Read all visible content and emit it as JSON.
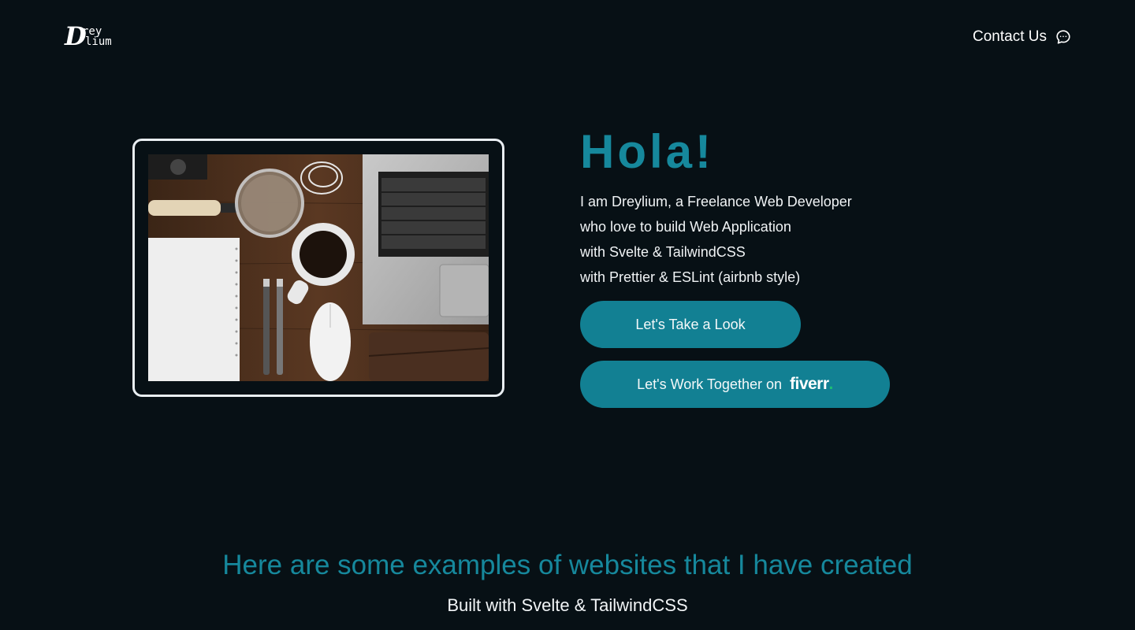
{
  "header": {
    "logo": {
      "big": "D",
      "line1": "rey",
      "line2": "lium"
    },
    "contact_label": "Contact Us",
    "contact_icon": "chat-bubble-icon"
  },
  "hero": {
    "image_alt": "Flat lay of a desk with notebook, magnifying glass, coffee cup, pens, mouse and laptop",
    "heading": "Hola!",
    "intro_lines": [
      "I am Dreylium, a Freelance Web Developer",
      "who love to build Web Application",
      "with Svelte & TailwindCSS",
      "with Prettier & ESLint (airbnb style)"
    ],
    "primary_button": "Let's Take a Look",
    "fiverr_button": "Let's Work Together on",
    "fiverr_logo_text": "fiverr",
    "fiverr_logo_dot": "."
  },
  "examples": {
    "title": "Here are some examples of websites that I have created",
    "subtitle": "Built with Svelte & TailwindCSS"
  },
  "colors": {
    "background": "#071015",
    "accent": "#16889c",
    "button": "#128093",
    "fiverr_green": "#1dbf73"
  }
}
